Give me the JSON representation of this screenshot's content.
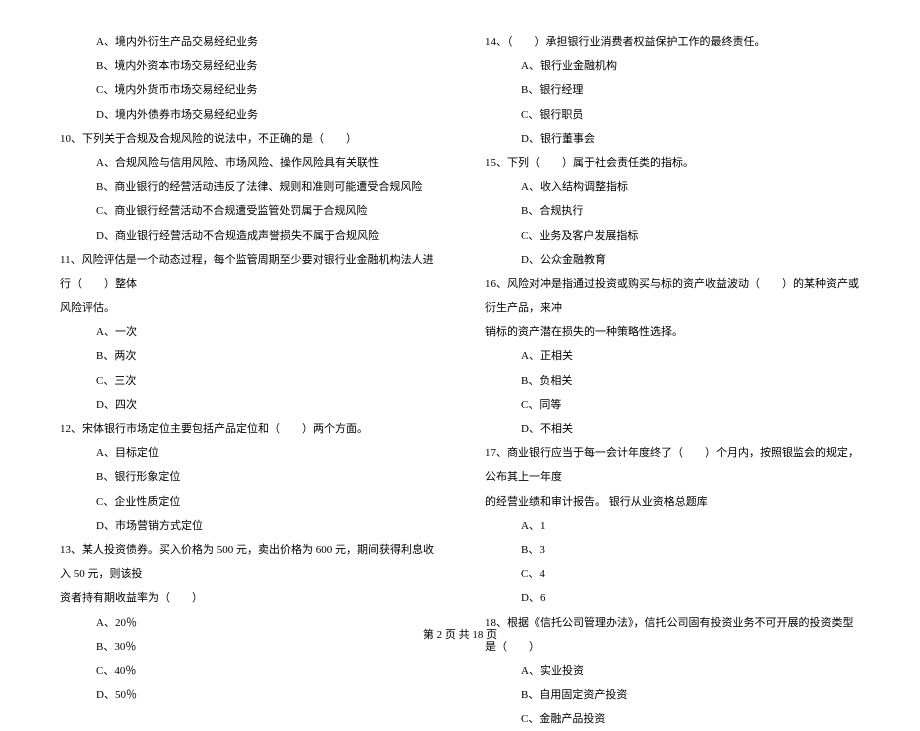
{
  "left_column": {
    "q9_options": [
      "A、境内外衍生产品交易经纪业务",
      "B、境内外资本市场交易经纪业务",
      "C、境内外货币市场交易经纪业务",
      "D、境内外债券市场交易经纪业务"
    ],
    "q10": "10、下列关于合规及合规风险的说法中，不正确的是（　　）",
    "q10_options": [
      "A、合规风险与信用风险、市场风险、操作风险具有关联性",
      "B、商业银行的经营活动违反了法律、规则和准则可能遭受合规风险",
      "C、商业银行经营活动不合规遭受监管处罚属于合规风险",
      "D、商业银行经营活动不合规造成声誉损失不属于合规风险"
    ],
    "q11_line1": "11、风险评估是一个动态过程，每个监管周期至少要对银行业金融机构法人进行（　　）整体",
    "q11_line2": "风险评估。",
    "q11_options": [
      "A、一次",
      "B、两次",
      "C、三次",
      "D、四次"
    ],
    "q12": "12、宋体银行市场定位主要包括产品定位和（　　）两个方面。",
    "q12_options": [
      "A、目标定位",
      "B、银行形象定位",
      "C、企业性质定位",
      "D、市场营销方式定位"
    ],
    "q13_line1": "13、某人投资债券。买入价格为 500 元，卖出价格为 600 元，期间获得利息收入 50 元，则该投",
    "q13_line2": "资者持有期收益率为（　　）",
    "q13_options": [
      "A、20％",
      "B、30％",
      "C、40％",
      "D、50％"
    ]
  },
  "right_column": {
    "q14": "14、（　　）承担银行业消费者权益保护工作的最终责任。",
    "q14_options": [
      "A、银行业金融机构",
      "B、银行经理",
      "C、银行职员",
      "D、银行董事会"
    ],
    "q15": "15、下列（　　）属于社会责任类的指标。",
    "q15_options": [
      "A、收入结构调整指标",
      "B、合规执行",
      "C、业务及客户发展指标",
      "D、公众金融教育"
    ],
    "q16_line1": "16、风险对冲是指通过投资或购买与标的资产收益波动（　　）的某种资产或衍生产品，来冲",
    "q16_line2": "销标的资产潜在损失的一种策略性选择。",
    "q16_options": [
      "A、正相关",
      "B、负相关",
      "C、同等",
      "D、不相关"
    ],
    "q17_line1": "17、商业银行应当于每一会计年度终了（　　）个月内，按照银监会的规定，公布其上一年度",
    "q17_line2": "的经营业绩和审计报告。 银行从业资格总题库",
    "q17_options": [
      "A、1",
      "B、3",
      "C、4",
      "D、6"
    ],
    "q18": "18、根据《信托公司管理办法》，信托公司固有投资业务不可开展的投资类型是（　　）",
    "q18_options": [
      "A、实业投资",
      "B、自用固定资产投资",
      "C、金融产品投资"
    ]
  },
  "footer": "第 2 页 共 18 页"
}
